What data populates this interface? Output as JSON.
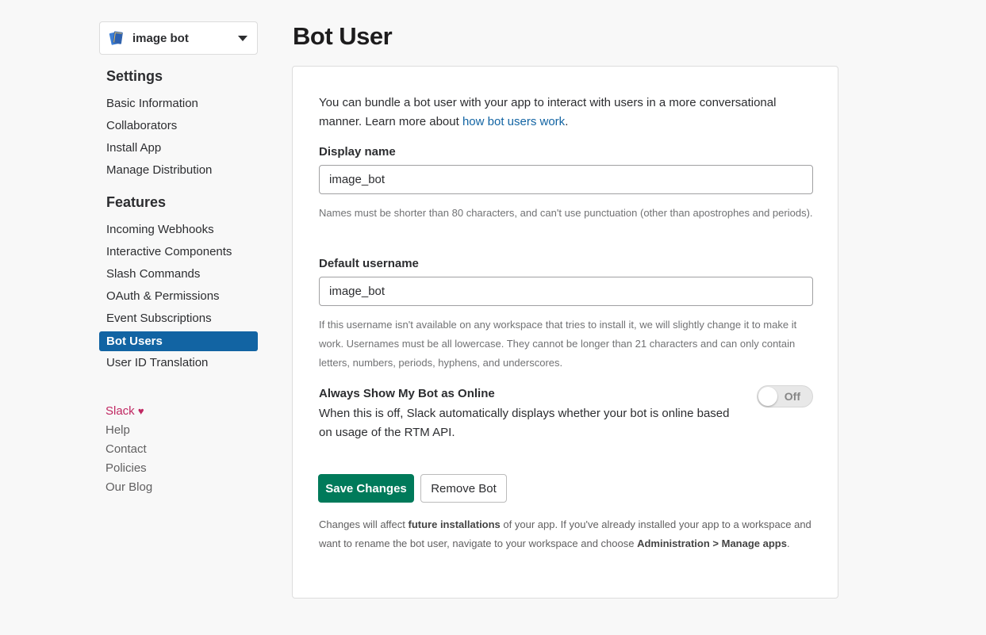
{
  "app_switcher": {
    "name": "image bot",
    "icon": "book-icon"
  },
  "sidebar": {
    "settings_title": "Settings",
    "settings_items": [
      {
        "label": "Basic Information"
      },
      {
        "label": "Collaborators"
      },
      {
        "label": "Install App"
      },
      {
        "label": "Manage Distribution"
      }
    ],
    "features_title": "Features",
    "features_items": [
      {
        "label": "Incoming Webhooks"
      },
      {
        "label": "Interactive Components"
      },
      {
        "label": "Slash Commands"
      },
      {
        "label": "OAuth & Permissions"
      },
      {
        "label": "Event Subscriptions"
      },
      {
        "label": "Bot Users",
        "active": true
      },
      {
        "label": "User ID Translation"
      }
    ],
    "footer_links": {
      "slack": "Slack",
      "heart": "♥",
      "help": "Help",
      "contact": "Contact",
      "policies": "Policies",
      "blog": "Our Blog"
    }
  },
  "main": {
    "title": "Bot User",
    "intro_text": "You can bundle a bot user with your app to interact with users in a more conversational manner. Learn more about ",
    "intro_link": "how bot users work",
    "intro_end": ".",
    "display_name": {
      "label": "Display name",
      "value": "image_bot",
      "hint": "Names must be shorter than 80 characters, and can't use punctuation (other than apostrophes and periods)."
    },
    "default_username": {
      "label": "Default username",
      "value": "image_bot",
      "hint": "If this username isn't available on any workspace that tries to install it, we will slightly change it to make it work. Usernames must be all lowercase. They cannot be longer than 21 characters and can only contain letters, numbers, periods, hyphens, and underscores."
    },
    "online_toggle": {
      "title": "Always Show My Bot as Online",
      "description": "When this is off, Slack automatically displays whether your bot is online based on usage of the RTM API.",
      "state_label": "Off"
    },
    "save_button": "Save Changes",
    "remove_button": "Remove Bot",
    "footer": {
      "part1": "Changes will affect ",
      "bold1": "future installations",
      "part2": " of your app. If you've already installed your app to a workspace and want to rename the bot user, navigate to your workspace and choose ",
      "bold2": "Administration > Manage apps",
      "part3": "."
    }
  },
  "colors": {
    "active_nav": "#1264a3",
    "primary_button": "#007a5a",
    "link": "#1264a3",
    "slack_link": "#c02862"
  }
}
